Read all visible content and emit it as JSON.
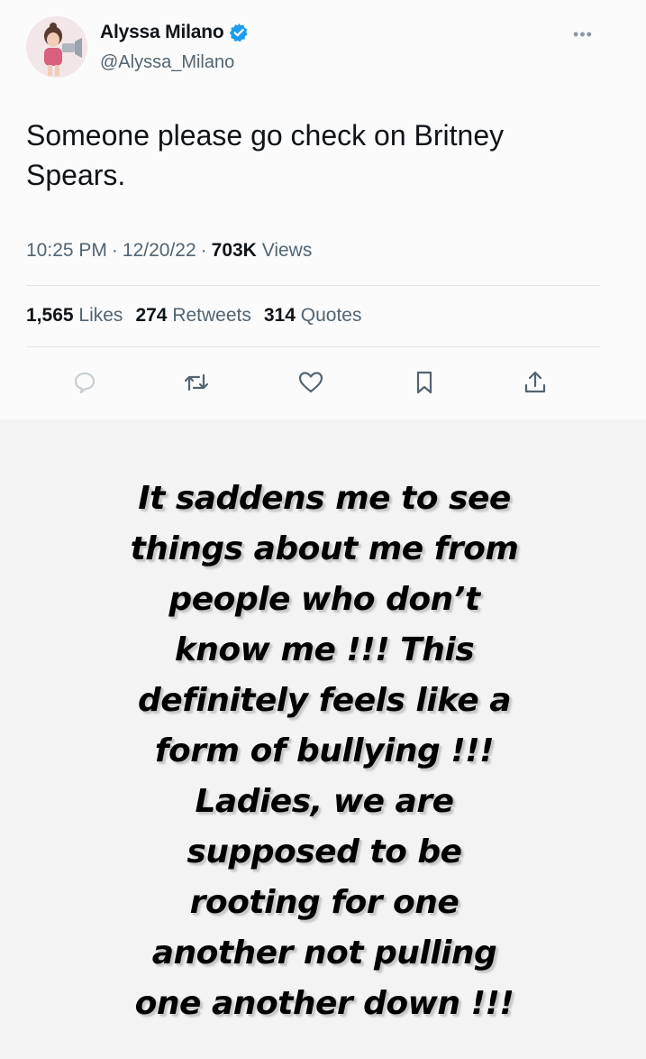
{
  "tweet": {
    "display_name": "Alyssa Milano",
    "handle": "@Alyssa_Milano",
    "text": "Someone please go check on Britney Spears.",
    "time": "10:25 PM",
    "date": "12/20/22",
    "views_count": "703K",
    "views_label": "Views",
    "stats": {
      "likes_count": "1,565",
      "likes_label": "Likes",
      "retweets_count": "274",
      "retweets_label": "Retweets",
      "quotes_count": "314",
      "quotes_label": "Quotes"
    },
    "actions": [
      "reply-icon",
      "retweet-icon",
      "like-icon",
      "bookmark-icon",
      "share-icon"
    ],
    "verified_color": "#1d9bf0"
  },
  "story": {
    "lines": [
      "It saddens me to see",
      "things about me from",
      "people who don’t",
      "know me !!! This",
      "definitely feels like a",
      "form of bullying !!!",
      "Ladies, we are",
      "supposed to be",
      "rooting for one",
      "another not pulling",
      "one another down !!!"
    ]
  }
}
